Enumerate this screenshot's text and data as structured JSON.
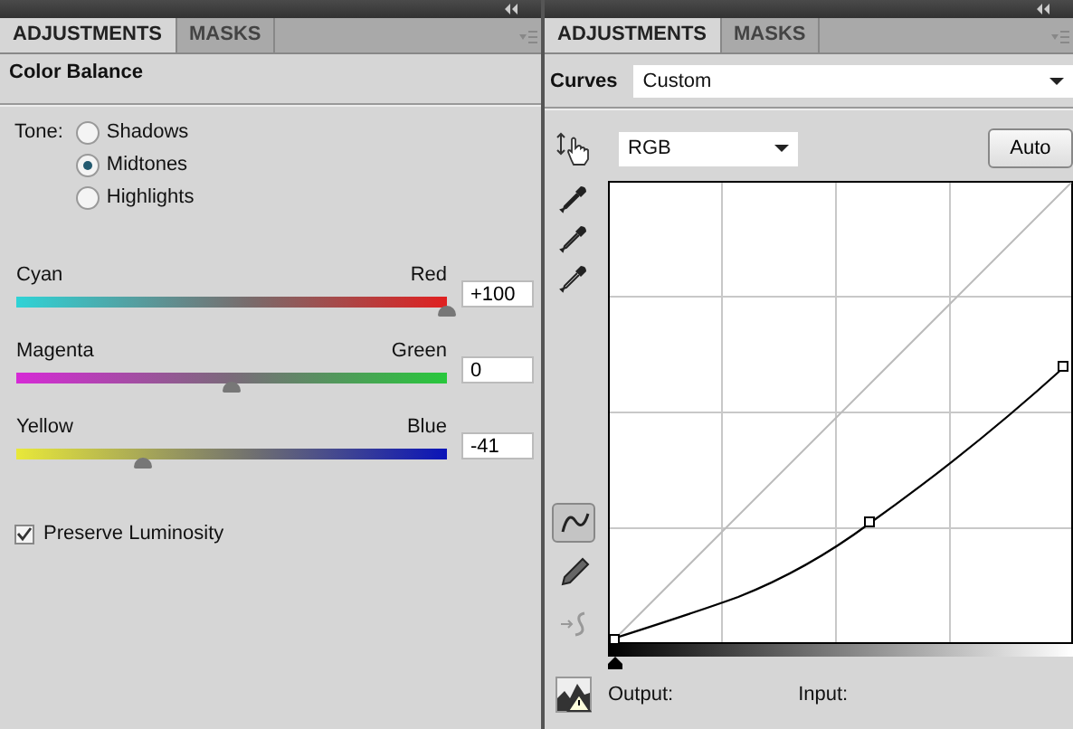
{
  "left_panel": {
    "tabs": [
      {
        "label": "ADJUSTMENTS",
        "selected": true
      },
      {
        "label": "MASKS",
        "selected": false
      }
    ],
    "title": "Color Balance",
    "tone": {
      "label": "Tone:",
      "options": [
        {
          "label": "Shadows",
          "selected": false
        },
        {
          "label": "Midtones",
          "selected": true
        },
        {
          "label": "Highlights",
          "selected": false
        }
      ]
    },
    "sliders": [
      {
        "left_label": "Cyan",
        "right_label": "Red",
        "level": 1,
        "value": "+100"
      },
      {
        "left_label": "Magenta",
        "right_label": "Green",
        "level": 0.5,
        "value": "0"
      },
      {
        "left_label": "Yellow",
        "right_label": "Blue",
        "level": 0.295,
        "value": "-41"
      }
    ],
    "preserve_luminosity": {
      "label": "Preserve Luminosity",
      "checked": true
    }
  },
  "right_panel": {
    "tabs": [
      {
        "label": "ADJUSTMENTS",
        "selected": true
      },
      {
        "label": "MASKS",
        "selected": false
      }
    ],
    "title": "Curves",
    "preset": "Custom",
    "channel": "RGB",
    "auto_button": "Auto",
    "tools": [
      {
        "kind": "curve",
        "selected": true
      },
      {
        "kind": "pencil",
        "selected": false
      },
      {
        "kind": "smooth",
        "selected": false
      }
    ],
    "input_shadow": {
      "level": 0
    },
    "output_label": "Output:",
    "input_label": "Input:"
  }
}
